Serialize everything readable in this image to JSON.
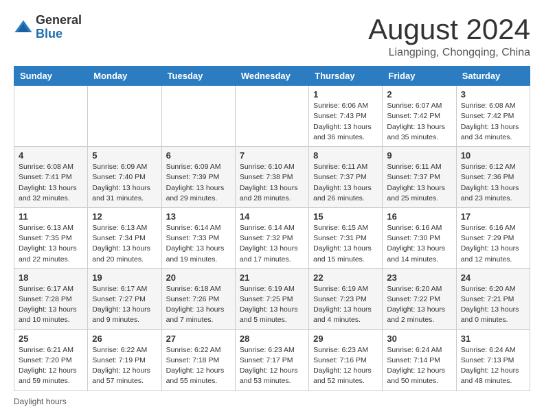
{
  "logo": {
    "general": "General",
    "blue": "Blue"
  },
  "title": "August 2024",
  "location": "Liangping, Chongqing, China",
  "days_of_week": [
    "Sunday",
    "Monday",
    "Tuesday",
    "Wednesday",
    "Thursday",
    "Friday",
    "Saturday"
  ],
  "footer": {
    "daylight_label": "Daylight hours"
  },
  "weeks": [
    [
      {
        "day": "",
        "info": ""
      },
      {
        "day": "",
        "info": ""
      },
      {
        "day": "",
        "info": ""
      },
      {
        "day": "",
        "info": ""
      },
      {
        "day": "1",
        "info": "Sunrise: 6:06 AM\nSunset: 7:43 PM\nDaylight: 13 hours\nand 36 minutes."
      },
      {
        "day": "2",
        "info": "Sunrise: 6:07 AM\nSunset: 7:42 PM\nDaylight: 13 hours\nand 35 minutes."
      },
      {
        "day": "3",
        "info": "Sunrise: 6:08 AM\nSunset: 7:42 PM\nDaylight: 13 hours\nand 34 minutes."
      }
    ],
    [
      {
        "day": "4",
        "info": "Sunrise: 6:08 AM\nSunset: 7:41 PM\nDaylight: 13 hours\nand 32 minutes."
      },
      {
        "day": "5",
        "info": "Sunrise: 6:09 AM\nSunset: 7:40 PM\nDaylight: 13 hours\nand 31 minutes."
      },
      {
        "day": "6",
        "info": "Sunrise: 6:09 AM\nSunset: 7:39 PM\nDaylight: 13 hours\nand 29 minutes."
      },
      {
        "day": "7",
        "info": "Sunrise: 6:10 AM\nSunset: 7:38 PM\nDaylight: 13 hours\nand 28 minutes."
      },
      {
        "day": "8",
        "info": "Sunrise: 6:11 AM\nSunset: 7:37 PM\nDaylight: 13 hours\nand 26 minutes."
      },
      {
        "day": "9",
        "info": "Sunrise: 6:11 AM\nSunset: 7:37 PM\nDaylight: 13 hours\nand 25 minutes."
      },
      {
        "day": "10",
        "info": "Sunrise: 6:12 AM\nSunset: 7:36 PM\nDaylight: 13 hours\nand 23 minutes."
      }
    ],
    [
      {
        "day": "11",
        "info": "Sunrise: 6:13 AM\nSunset: 7:35 PM\nDaylight: 13 hours\nand 22 minutes."
      },
      {
        "day": "12",
        "info": "Sunrise: 6:13 AM\nSunset: 7:34 PM\nDaylight: 13 hours\nand 20 minutes."
      },
      {
        "day": "13",
        "info": "Sunrise: 6:14 AM\nSunset: 7:33 PM\nDaylight: 13 hours\nand 19 minutes."
      },
      {
        "day": "14",
        "info": "Sunrise: 6:14 AM\nSunset: 7:32 PM\nDaylight: 13 hours\nand 17 minutes."
      },
      {
        "day": "15",
        "info": "Sunrise: 6:15 AM\nSunset: 7:31 PM\nDaylight: 13 hours\nand 15 minutes."
      },
      {
        "day": "16",
        "info": "Sunrise: 6:16 AM\nSunset: 7:30 PM\nDaylight: 13 hours\nand 14 minutes."
      },
      {
        "day": "17",
        "info": "Sunrise: 6:16 AM\nSunset: 7:29 PM\nDaylight: 13 hours\nand 12 minutes."
      }
    ],
    [
      {
        "day": "18",
        "info": "Sunrise: 6:17 AM\nSunset: 7:28 PM\nDaylight: 13 hours\nand 10 minutes."
      },
      {
        "day": "19",
        "info": "Sunrise: 6:17 AM\nSunset: 7:27 PM\nDaylight: 13 hours\nand 9 minutes."
      },
      {
        "day": "20",
        "info": "Sunrise: 6:18 AM\nSunset: 7:26 PM\nDaylight: 13 hours\nand 7 minutes."
      },
      {
        "day": "21",
        "info": "Sunrise: 6:19 AM\nSunset: 7:25 PM\nDaylight: 13 hours\nand 5 minutes."
      },
      {
        "day": "22",
        "info": "Sunrise: 6:19 AM\nSunset: 7:23 PM\nDaylight: 13 hours\nand 4 minutes."
      },
      {
        "day": "23",
        "info": "Sunrise: 6:20 AM\nSunset: 7:22 PM\nDaylight: 13 hours\nand 2 minutes."
      },
      {
        "day": "24",
        "info": "Sunrise: 6:20 AM\nSunset: 7:21 PM\nDaylight: 13 hours\nand 0 minutes."
      }
    ],
    [
      {
        "day": "25",
        "info": "Sunrise: 6:21 AM\nSunset: 7:20 PM\nDaylight: 12 hours\nand 59 minutes."
      },
      {
        "day": "26",
        "info": "Sunrise: 6:22 AM\nSunset: 7:19 PM\nDaylight: 12 hours\nand 57 minutes."
      },
      {
        "day": "27",
        "info": "Sunrise: 6:22 AM\nSunset: 7:18 PM\nDaylight: 12 hours\nand 55 minutes."
      },
      {
        "day": "28",
        "info": "Sunrise: 6:23 AM\nSunset: 7:17 PM\nDaylight: 12 hours\nand 53 minutes."
      },
      {
        "day": "29",
        "info": "Sunrise: 6:23 AM\nSunset: 7:16 PM\nDaylight: 12 hours\nand 52 minutes."
      },
      {
        "day": "30",
        "info": "Sunrise: 6:24 AM\nSunset: 7:14 PM\nDaylight: 12 hours\nand 50 minutes."
      },
      {
        "day": "31",
        "info": "Sunrise: 6:24 AM\nSunset: 7:13 PM\nDaylight: 12 hours\nand 48 minutes."
      }
    ]
  ]
}
